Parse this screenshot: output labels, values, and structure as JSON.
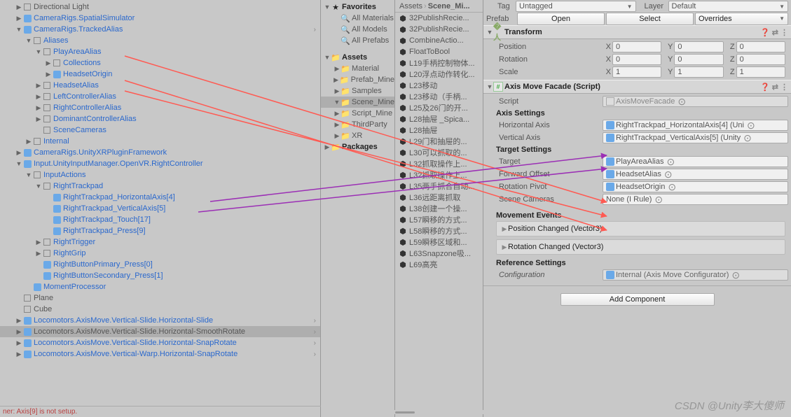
{
  "hierarchy": [
    {
      "d": 1,
      "t": "r",
      "lbl": "Directional Light",
      "blue": false
    },
    {
      "d": 1,
      "t": "r",
      "lbl": "CameraRigs.SpatialSimulator",
      "blue": true,
      "pf": true
    },
    {
      "d": 1,
      "t": "o",
      "lbl": "CameraRigs.TrackedAlias",
      "blue": true,
      "pf": true,
      "chev": true
    },
    {
      "d": 2,
      "t": "o",
      "lbl": "Aliases",
      "blue": true
    },
    {
      "d": 3,
      "t": "o",
      "lbl": "PlayAreaAlias",
      "blue": true
    },
    {
      "d": 4,
      "t": "r",
      "lbl": "Collections",
      "blue": true
    },
    {
      "d": 4,
      "t": "r",
      "lbl": "HeadsetOrigin",
      "blue": true,
      "pf": true
    },
    {
      "d": 3,
      "t": "r",
      "lbl": "HeadsetAlias",
      "blue": true
    },
    {
      "d": 3,
      "t": "r",
      "lbl": "LeftControllerAlias",
      "blue": true
    },
    {
      "d": 3,
      "t": "r",
      "lbl": "RightControllerAlias",
      "blue": true
    },
    {
      "d": 3,
      "t": "r",
      "lbl": "DominantControllerAlias",
      "blue": true
    },
    {
      "d": 3,
      "t": "n",
      "lbl": "SceneCameras",
      "blue": true
    },
    {
      "d": 2,
      "t": "r",
      "lbl": "Internal",
      "blue": true
    },
    {
      "d": 1,
      "t": "r",
      "lbl": "CameraRigs.UnityXRPluginFramework",
      "blue": true,
      "pf": true
    },
    {
      "d": 1,
      "t": "o",
      "lbl": "Input.UnityInputManager.OpenVR.RightController",
      "blue": true,
      "pf": true
    },
    {
      "d": 2,
      "t": "o",
      "lbl": "InputActions",
      "blue": true
    },
    {
      "d": 3,
      "t": "o",
      "lbl": "RightTrackpad",
      "blue": true
    },
    {
      "d": 4,
      "t": "n",
      "lbl": "RightTrackpad_HorizontalAxis[4]",
      "blue": true,
      "pf": true
    },
    {
      "d": 4,
      "t": "n",
      "lbl": "RightTrackpad_VerticalAxis[5]",
      "blue": true,
      "pf": true
    },
    {
      "d": 4,
      "t": "n",
      "lbl": "RightTrackpad_Touch[17]",
      "blue": true,
      "pf": true
    },
    {
      "d": 4,
      "t": "n",
      "lbl": "RightTrackpad_Press[9]",
      "blue": true,
      "pf": true
    },
    {
      "d": 3,
      "t": "r",
      "lbl": "RightTrigger",
      "blue": true
    },
    {
      "d": 3,
      "t": "r",
      "lbl": "RightGrip",
      "blue": true
    },
    {
      "d": 3,
      "t": "n",
      "lbl": "RightButtonPrimary_Press[0]",
      "blue": true,
      "pf": true
    },
    {
      "d": 3,
      "t": "n",
      "lbl": "RightButtonSecondary_Press[1]",
      "blue": true,
      "pf": true
    },
    {
      "d": 2,
      "t": "n",
      "lbl": "MomentProcessor",
      "blue": true,
      "pf": true
    },
    {
      "d": 1,
      "t": "n",
      "lbl": "Plane",
      "blue": false
    },
    {
      "d": 1,
      "t": "n",
      "lbl": "Cube",
      "blue": false
    },
    {
      "d": 1,
      "t": "r",
      "lbl": "Locomotors.AxisMove.Vertical-Slide.Horizontal-Slide",
      "blue": true,
      "pf": true,
      "chev": true
    },
    {
      "d": 1,
      "t": "r",
      "lbl": "Locomotors.AxisMove.Vertical-Slide.Horizontal-SmoothRotate",
      "blue": false,
      "pf": true,
      "chev": true,
      "sel": true
    },
    {
      "d": 1,
      "t": "r",
      "lbl": "Locomotors.AxisMove.Vertical-Slide.Horizontal-SnapRotate",
      "blue": true,
      "pf": true,
      "chev": true
    },
    {
      "d": 1,
      "t": "r",
      "lbl": "Locomotors.AxisMove.Vertical-Warp.Horizontal-SnapRotate",
      "blue": true,
      "pf": true,
      "chev": true
    }
  ],
  "favorites": {
    "title": "Favorites",
    "items": [
      "All Materials",
      "All Models",
      "All Prefabs"
    ]
  },
  "assets": {
    "title": "Assets",
    "items": [
      {
        "t": "r",
        "lbl": "Material"
      },
      {
        "t": "r",
        "lbl": "Prefab_Mine"
      },
      {
        "t": "r",
        "lbl": "Samples"
      },
      {
        "t": "o",
        "lbl": "Scene_Mine",
        "sel": true
      },
      {
        "t": "r",
        "lbl": "Script_Mine"
      },
      {
        "t": "r",
        "lbl": "ThirdParty"
      },
      {
        "t": "r",
        "lbl": "XR"
      }
    ],
    "pkgs": "Packages"
  },
  "crumb": {
    "a": "Assets",
    "b": "Scene_Mi..."
  },
  "scenes": [
    "32PublishRecie...",
    "32PublishRecie...",
    "CombineActio...",
    "FloatToBool",
    "L19手柄控制物体...",
    "L20浮点动作转化...",
    "L23移动",
    "L23移动（手柄...",
    "L25及26门的开...",
    "L28抽屉 _Spica...",
    "L28抽屉",
    "L29门和抽屉的...",
    "L30可以抓取的...",
    "L32抓取操作上...",
    "L32抓取操作上...",
    "L35两手抓合自动...",
    "L36远距离抓取",
    "L38创建一个操...",
    "L57瞬移的方式...",
    "L58瞬移的方式...",
    "L59瞬移区域和...",
    "L63Snapzone吸...",
    "L69高亮"
  ],
  "insp": {
    "tag_lbl": "Tag",
    "tag_val": "Untagged",
    "layer_lbl": "Layer",
    "layer_val": "Default",
    "prefab_lbl": "Prefab",
    "open": "Open",
    "select": "Select",
    "overrides": "Overrides",
    "transform_title": "Transform",
    "pos_lbl": "Position",
    "rot_lbl": "Rotation",
    "scl_lbl": "Scale",
    "x": "X",
    "y": "Y",
    "z": "Z",
    "pos": {
      "x": "0",
      "y": "0",
      "z": "0"
    },
    "rot": {
      "x": "0",
      "y": "0",
      "z": "0"
    },
    "scl": {
      "x": "1",
      "y": "1",
      "z": "1"
    },
    "script_title": "Axis Move Facade (Script)",
    "script_lbl": "Script",
    "script_val": "AxisMoveFacade",
    "axis_hdr": "Axis Settings",
    "h_axis_lbl": "Horizontal Axis",
    "h_axis_val": "RightTrackpad_HorizontalAxis[4] (Uni",
    "v_axis_lbl": "Vertical Axis",
    "v_axis_val": "RightTrackpad_VerticalAxis[5] (Unity",
    "tgt_hdr": "Target Settings",
    "target_lbl": "Target",
    "target_val": "PlayAreaAlias",
    "fwd_lbl": "Forward Offset",
    "fwd_val": "HeadsetAlias",
    "rot_pivot_lbl": "Rotation Pivot",
    "rot_pivot_val": "HeadsetOrigin",
    "cam_lbl": "Scene Cameras",
    "cam_val": "None (I Rule)",
    "mv_hdr": "Movement Events",
    "pos_ev": "Position Changed (Vector3)",
    "rot_ev": "Rotation Changed (Vector3)",
    "ref_hdr": "Reference Settings",
    "cfg_lbl": "Configuration",
    "cfg_val": "Internal (Axis Move Configurator)",
    "add": "Add Component"
  },
  "footer": "ner: Axis[9] is not setup.",
  "watermark": "CSDN @Unity李大傻师"
}
